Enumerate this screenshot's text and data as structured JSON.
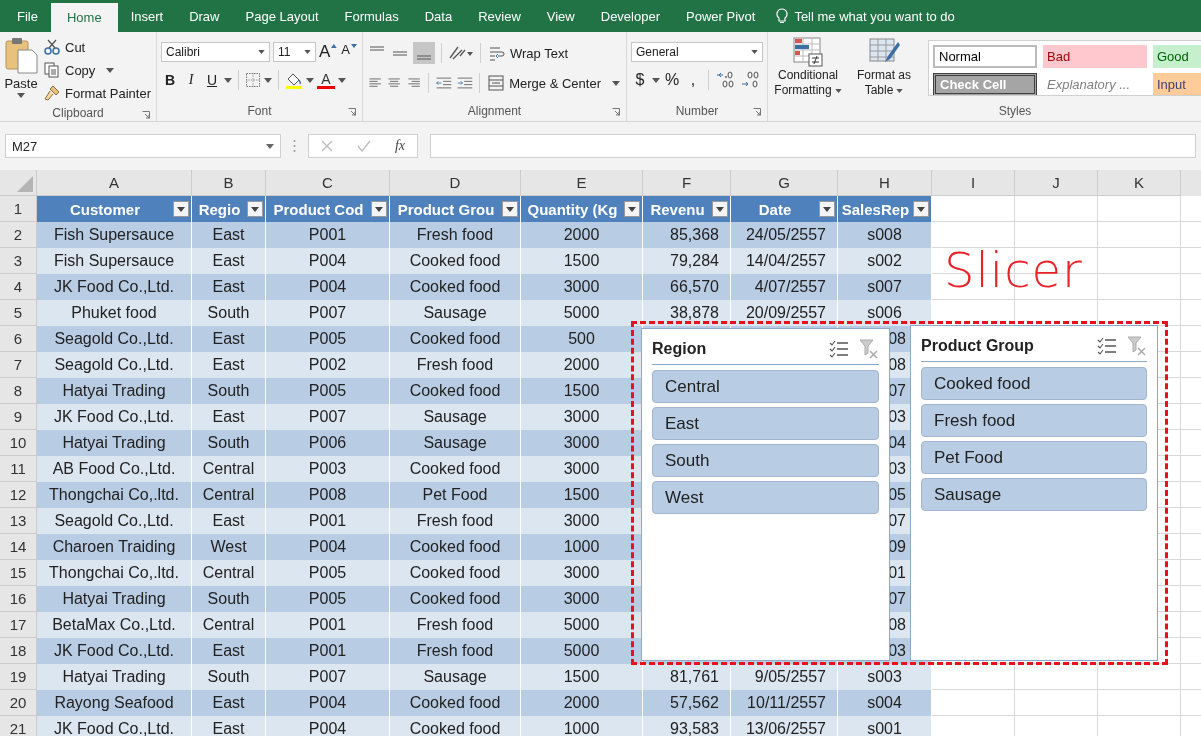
{
  "ribbon_tabs": [
    {
      "label": "File",
      "selected": false
    },
    {
      "label": "Home",
      "selected": true
    },
    {
      "label": "Insert",
      "selected": false
    },
    {
      "label": "Draw",
      "selected": false
    },
    {
      "label": "Page Layout",
      "selected": false
    },
    {
      "label": "Formulas",
      "selected": false
    },
    {
      "label": "Data",
      "selected": false
    },
    {
      "label": "Review",
      "selected": false
    },
    {
      "label": "View",
      "selected": false
    },
    {
      "label": "Developer",
      "selected": false
    },
    {
      "label": "Power Pivot",
      "selected": false
    }
  ],
  "tell_me": "Tell me what you want to do",
  "clipboard": {
    "paste": "Paste",
    "cut": "Cut",
    "copy": "Copy",
    "format_painter": "Format Painter",
    "label": "Clipboard"
  },
  "font": {
    "name": "Calibri",
    "size": "11",
    "grow": "A",
    "shrink": "A",
    "bold": "B",
    "italic": "I",
    "underline": "U",
    "color_letter": "A",
    "label": "Font"
  },
  "alignment": {
    "wrap_text": "Wrap Text",
    "merge": "Merge & Center",
    "label": "Alignment"
  },
  "number": {
    "format": "General",
    "currency": "$",
    "percent": "%",
    "comma": ",",
    "label": "Number"
  },
  "styles": {
    "conditional": [
      "Conditional",
      "Formatting"
    ],
    "format_table": [
      "Format as",
      "Table"
    ],
    "cells": [
      {
        "label": "Normal",
        "kind": "normal"
      },
      {
        "label": "Bad",
        "kind": "bad"
      },
      {
        "label": "Good",
        "kind": "good"
      },
      {
        "label": "Check Cell",
        "kind": "check"
      },
      {
        "label": "Explanatory ...",
        "kind": "explanatory"
      },
      {
        "label": "Input",
        "kind": "input"
      }
    ],
    "label": "Styles"
  },
  "name_box": "M27",
  "fx": "fx",
  "columns": [
    "A",
    "B",
    "C",
    "D",
    "E",
    "F",
    "G",
    "H",
    "I",
    "J",
    "K"
  ],
  "table": {
    "header_row": "1",
    "headers": [
      "Customer",
      "Regio",
      "Product Cod",
      "Product Grou",
      "Quantity (Kg",
      "Revenu",
      "Date",
      "SalesRep"
    ],
    "rows": [
      {
        "num": "2",
        "cells": [
          "Fish Supersauce",
          "East",
          "P001",
          "Fresh food",
          "2000",
          "85,368",
          "24/05/2557",
          "s008"
        ]
      },
      {
        "num": "3",
        "cells": [
          "Fish Supersauce",
          "East",
          "P004",
          "Cooked food",
          "1500",
          "79,284",
          "14/04/2557",
          "s002"
        ]
      },
      {
        "num": "4",
        "cells": [
          "JK Food Co.,Ltd.",
          "East",
          "P004",
          "Cooked food",
          "3000",
          "66,570",
          "4/07/2557",
          "s007"
        ]
      },
      {
        "num": "5",
        "cells": [
          "Phuket food",
          "South",
          "P007",
          "Sausage",
          "5000",
          "38,878",
          "20/09/2557",
          "s006"
        ]
      },
      {
        "num": "6",
        "cells": [
          "Seagold Co.,Ltd.",
          "East",
          "P005",
          "Cooked food",
          "500",
          null,
          null,
          "08"
        ]
      },
      {
        "num": "7",
        "cells": [
          "Seagold Co.,Ltd.",
          "East",
          "P002",
          "Fresh food",
          "2000",
          null,
          null,
          "08"
        ]
      },
      {
        "num": "8",
        "cells": [
          "Hatyai Trading",
          "South",
          "P005",
          "Cooked food",
          "1500",
          null,
          null,
          "07"
        ]
      },
      {
        "num": "9",
        "cells": [
          "JK Food Co.,Ltd.",
          "East",
          "P007",
          "Sausage",
          "3000",
          null,
          null,
          "03"
        ]
      },
      {
        "num": "10",
        "cells": [
          "Hatyai Trading",
          "South",
          "P006",
          "Sausage",
          "3000",
          null,
          null,
          "04"
        ]
      },
      {
        "num": "11",
        "cells": [
          "AB Food Co.,Ltd.",
          "Central",
          "P003",
          "Cooked food",
          "3000",
          null,
          null,
          "03"
        ]
      },
      {
        "num": "12",
        "cells": [
          "Thongchai Co,.ltd.",
          "Central",
          "P008",
          "Pet Food",
          "1500",
          null,
          null,
          "05"
        ]
      },
      {
        "num": "13",
        "cells": [
          "Seagold Co.,Ltd.",
          "East",
          "P001",
          "Fresh food",
          "3000",
          null,
          null,
          "07"
        ]
      },
      {
        "num": "14",
        "cells": [
          "Charoen Traiding",
          "West",
          "P004",
          "Cooked food",
          "1000",
          null,
          null,
          "09"
        ]
      },
      {
        "num": "15",
        "cells": [
          "Thongchai Co,.ltd.",
          "Central",
          "P005",
          "Cooked food",
          "3000",
          null,
          null,
          "01"
        ]
      },
      {
        "num": "16",
        "cells": [
          "Hatyai Trading",
          "South",
          "P005",
          "Cooked food",
          "3000",
          null,
          null,
          "07"
        ]
      },
      {
        "num": "17",
        "cells": [
          "BetaMax Co.,Ltd.",
          "Central",
          "P001",
          "Fresh food",
          "5000",
          null,
          null,
          "08"
        ]
      },
      {
        "num": "18",
        "cells": [
          "JK Food Co.,Ltd.",
          "East",
          "P001",
          "Fresh food",
          "5000",
          null,
          null,
          "03"
        ]
      },
      {
        "num": "19",
        "cells": [
          "Hatyai Trading",
          "South",
          "P007",
          "Sausage",
          "1500",
          "81,761",
          "9/05/2557",
          "s003"
        ]
      },
      {
        "num": "20",
        "cells": [
          "Rayong Seafood",
          "East",
          "P004",
          "Cooked food",
          "2000",
          "57,562",
          "10/11/2557",
          "s004"
        ]
      },
      {
        "num": "21",
        "cells": [
          "JK Food Co.,Ltd.",
          "East",
          "P004",
          "Cooked food",
          "1000",
          "93,583",
          "13/06/2557",
          "s001"
        ]
      }
    ]
  },
  "annotation": "Slicer",
  "slicers": [
    {
      "title": "Region",
      "items": [
        {
          "label": "Central",
          "selected": true
        },
        {
          "label": "East",
          "selected": true
        },
        {
          "label": "South",
          "selected": true
        },
        {
          "label": "West",
          "selected": true
        }
      ]
    },
    {
      "title": "Product Group",
      "items": [
        {
          "label": "Cooked food",
          "selected": true
        },
        {
          "label": "Fresh food",
          "selected": true
        },
        {
          "label": "Pet Food",
          "selected": true
        },
        {
          "label": "Sausage",
          "selected": true
        }
      ]
    }
  ]
}
